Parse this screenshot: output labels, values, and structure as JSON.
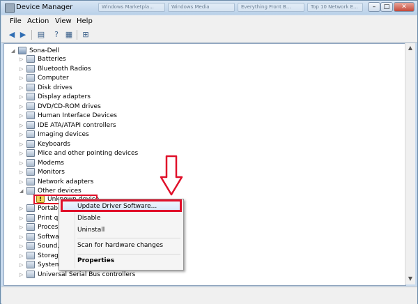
{
  "window": {
    "title": "Device Manager",
    "background_tabs": [
      "Windows Marketpla...",
      "Windows Media",
      "Everything Front B...",
      "Top 10 Network E..."
    ]
  },
  "menubar": {
    "items": [
      "File",
      "Action",
      "View",
      "Help"
    ]
  },
  "toolbar": {
    "icons": [
      "back-arrow-icon",
      "forward-arrow-icon",
      "properties-icon",
      "help-icon",
      "scan-hardware-icon"
    ]
  },
  "tree": {
    "root": "Sona-Dell",
    "items": [
      {
        "label": "Batteries",
        "icon": "battery-icon"
      },
      {
        "label": "Bluetooth Radios",
        "icon": "bluetooth-icon"
      },
      {
        "label": "Computer",
        "icon": "computer-icon"
      },
      {
        "label": "Disk drives",
        "icon": "disk-drive-icon"
      },
      {
        "label": "Display adapters",
        "icon": "display-adapter-icon"
      },
      {
        "label": "DVD/CD-ROM drives",
        "icon": "dvd-drive-icon"
      },
      {
        "label": "Human Interface Devices",
        "icon": "hid-icon"
      },
      {
        "label": "IDE ATA/ATAPI controllers",
        "icon": "ide-controller-icon"
      },
      {
        "label": "Imaging devices",
        "icon": "camera-icon"
      },
      {
        "label": "Keyboards",
        "icon": "keyboard-icon"
      },
      {
        "label": "Mice and other pointing devices",
        "icon": "mouse-icon"
      },
      {
        "label": "Modems",
        "icon": "modem-icon"
      },
      {
        "label": "Monitors",
        "icon": "monitor-icon"
      },
      {
        "label": "Network adapters",
        "icon": "network-adapter-icon"
      },
      {
        "label": "Other devices",
        "icon": "other-devices-icon"
      }
    ],
    "other_devices_child": "Unknown device",
    "partial_items": [
      {
        "label": "Portable",
        "icon": "portable-device-icon"
      },
      {
        "label": "Print qu",
        "icon": "printer-icon"
      },
      {
        "label": "Processo",
        "icon": "processor-icon"
      },
      {
        "label": "Software",
        "icon": "software-device-icon"
      },
      {
        "label": "Sound, v",
        "icon": "sound-icon"
      },
      {
        "label": "Storage",
        "icon": "storage-icon"
      },
      {
        "label": "System devices",
        "icon": "system-device-icon"
      },
      {
        "label": "Universal Serial Bus controllers",
        "icon": "usb-icon"
      }
    ]
  },
  "context_menu": {
    "update": "Update Driver Software...",
    "disable": "Disable",
    "uninstall": "Uninstall",
    "scan": "Scan for hardware changes",
    "properties": "Properties"
  },
  "colors": {
    "annotation_red": "#e0102a",
    "highlight_blue": "#d8e8fa"
  }
}
